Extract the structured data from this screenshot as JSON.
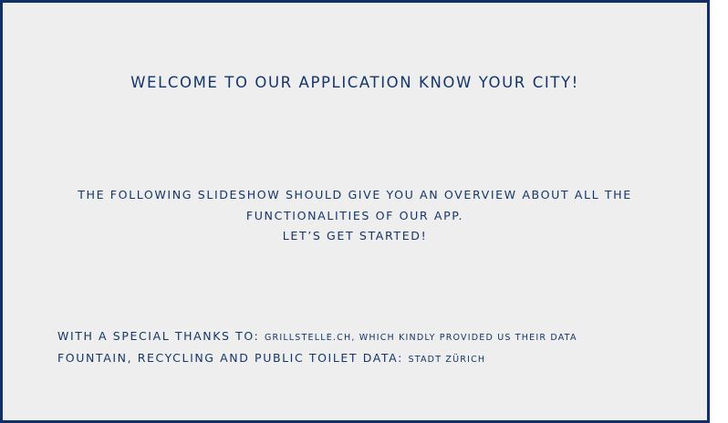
{
  "slide": {
    "title": "WELCOME TO OUR APPLICATION KNOW YOUR CITY!",
    "intro_lines": [
      "THE FOLLOWING SLIDESHOW SHOULD GIVE YOU AN OVERVIEW ABOUT ALL THE",
      "FUNCTIONALITIES OF OUR APP.",
      "LET’S GET STARTED!"
    ],
    "credits": [
      {
        "heading": "WITH A SPECIAL THANKS TO:",
        "detail": "GRILLSTELLE.CH, WHICH KINDLY PROVIDED US THEIR DATA"
      },
      {
        "heading": "FOUNTAIN, RECYCLING AND PUBLIC TOILET DATA:",
        "detail": "STADT ZÜRICH"
      }
    ]
  },
  "colors": {
    "text": "#14356e",
    "border": "#0f2f66",
    "background": "#eeeeee"
  }
}
